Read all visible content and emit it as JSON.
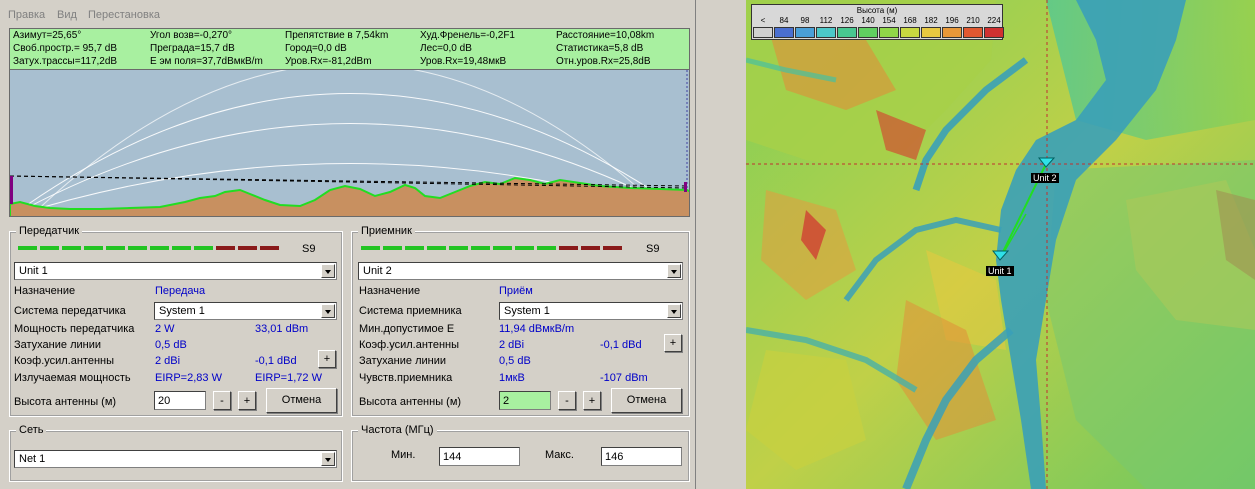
{
  "menu": [
    "Правка",
    "Вид",
    "Перестановка"
  ],
  "info_rows": [
    [
      "Азимут=25,65°",
      "Угол возв=-0,270°",
      "Препятствие в 7,54km",
      "Худ.Френель=-0,2F1",
      "Расстояние=10,08km"
    ],
    [
      "Своб.простр.= 95,7 dB",
      "Преграда=15,7 dB",
      "Город=0,0 dB",
      "Лес=0,0 dB",
      "Статистика=5,8 dB"
    ],
    [
      "Затух.трассы=117,2dB",
      "Е эм поля=37,7dBмкВ/m",
      "Уров.Rx=-81,2dBm",
      "Уров.Rx=19,48мкВ",
      "Отн.уров.Rx=25,8dB"
    ]
  ],
  "transmitter": {
    "title": "Передатчик",
    "meter_label": "S9",
    "unit": "Unit 1",
    "labels": [
      "Назначение",
      "Система передатчика",
      "Мощность передатчика",
      "Затухание линии",
      "Коэф.усил.антенны",
      "Излучаемая мощность",
      "Высота антенны (м)"
    ],
    "purpose": "Передача",
    "system": "System 1",
    "power_w": "2 W",
    "power_dbm": "33,01 dBm",
    "line_loss": "0,5 dB",
    "gain_dbi": "2 dBi",
    "gain_dbd": "-0,1 dBd",
    "eirp": "EIRP=2,83 W",
    "erp": "EIRP=1,72 W",
    "height": "20",
    "minus": "-",
    "plus": "+",
    "cancel": "Отмена"
  },
  "receiver": {
    "title": "Приемник",
    "meter_label": "S9",
    "unit": "Unit 2",
    "labels": [
      "Назначение",
      "Система приемника",
      "Мин.допустимое Е",
      "Коэф.усил.антенны",
      "Затухание линии",
      "Чувств.приемника",
      "Высота антенны (м)"
    ],
    "purpose": "Приём",
    "system": "System 1",
    "min_e": "11,94 dBмкВ/m",
    "gain_dbi": "2 dBi",
    "gain_dbd": "-0,1 dBd",
    "line_loss": "0,5 dB",
    "sens_uv": "1мкВ",
    "sens_dbm": "-107 dBm",
    "height": "2",
    "minus": "-",
    "plus": "+",
    "cancel": "Отмена"
  },
  "network": {
    "title": "Сеть",
    "value": "Net 1"
  },
  "frequency": {
    "title": "Частота (МГц)",
    "min_label": "Мин.",
    "min": "144",
    "max_label": "Макс.",
    "max": "146"
  },
  "map": {
    "legend_title": "Высота (м)",
    "legend_values": [
      "<",
      "84",
      "98",
      "112",
      "126",
      "140",
      "154",
      "168",
      "182",
      "196",
      "210",
      "224"
    ],
    "legend_colors": [
      "#d0d0d0",
      "#4a6fd0",
      "#4aa0d8",
      "#4cc8c8",
      "#48c890",
      "#60d060",
      "#90d848",
      "#c8d840",
      "#e8c840",
      "#e89838",
      "#e05830",
      "#d03030"
    ],
    "unit1": "Unit 1",
    "unit2": "Unit 2"
  }
}
